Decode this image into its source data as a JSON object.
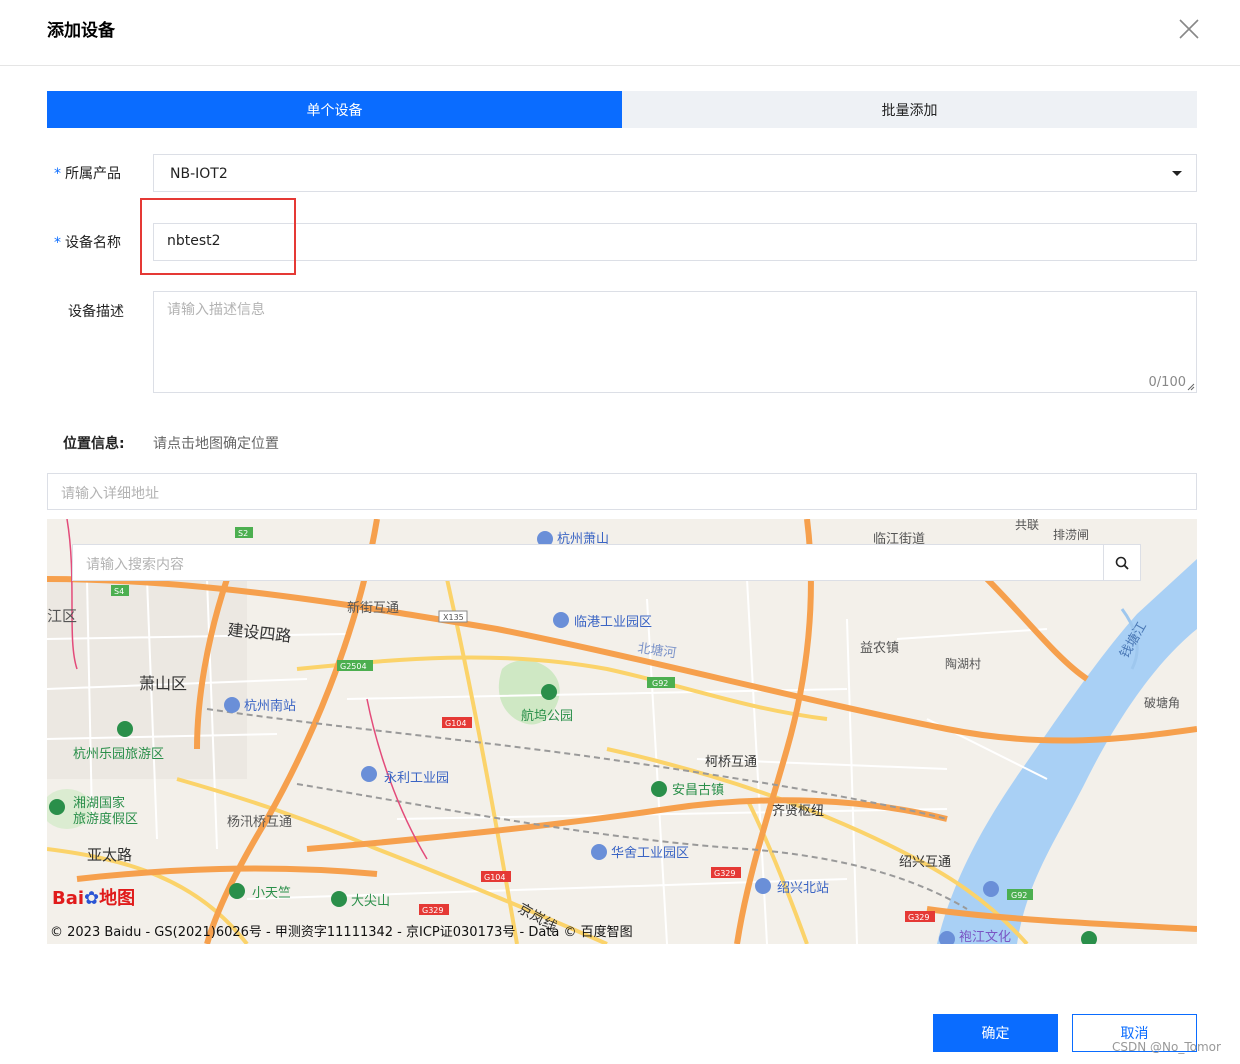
{
  "dialog": {
    "title": "添加设备"
  },
  "tabs": [
    {
      "label": "单个设备",
      "active": true
    },
    {
      "label": "批量添加",
      "active": false
    }
  ],
  "form": {
    "product_label": "所属产品",
    "product_value": "NB-IOT2",
    "name_label": "设备名称",
    "name_value": "nbtest2",
    "desc_label": "设备描述",
    "desc_placeholder": "请输入描述信息",
    "desc_counter": "0/100",
    "required_mark": "*"
  },
  "location": {
    "label": "位置信息:",
    "hint": "请点击地图确定位置",
    "address_placeholder": "请输入详细地址",
    "search_placeholder": "请输入搜索内容"
  },
  "map": {
    "copyright": "© 2023 Baidu - GS(2021)6026号 - 甲测资字11111342 - 京ICP证030173号 - Data © 百度智图",
    "logo_text_a": "Bai",
    "logo_text_b": "地图",
    "places": [
      "萧山区",
      "杭州南站",
      "建设四路",
      "新街互通",
      "临港工业园区",
      "北塘河",
      "益农镇",
      "陶湖村",
      "航坞公园",
      "杭州乐园旅游区",
      "永利工业园",
      "柯桥互通",
      "安昌古镇",
      "齐贤枢纽",
      "湘湖国家",
      "旅游度假区",
      "杨汛桥互通",
      "亚太路",
      "华舍工业园区",
      "绍兴北站",
      "绍兴互通",
      "小天竺",
      "大尖山",
      "钱塘江",
      "破塘角",
      "临江街道",
      "排涝闸",
      "共联",
      "杭州萧山",
      "江区",
      "京岚线",
      "袍江文化"
    ],
    "road_badges": [
      "S2",
      "S4",
      "X135",
      "G2504",
      "G92",
      "G104",
      "G104",
      "G329",
      "G329",
      "G329",
      "G92"
    ]
  },
  "footer": {
    "ok_label": "确定",
    "cancel_label": "取消",
    "watermark": "CSDN @No_Tomor"
  },
  "colors": {
    "primary": "#0a6cff",
    "highlight": "#e53935"
  }
}
